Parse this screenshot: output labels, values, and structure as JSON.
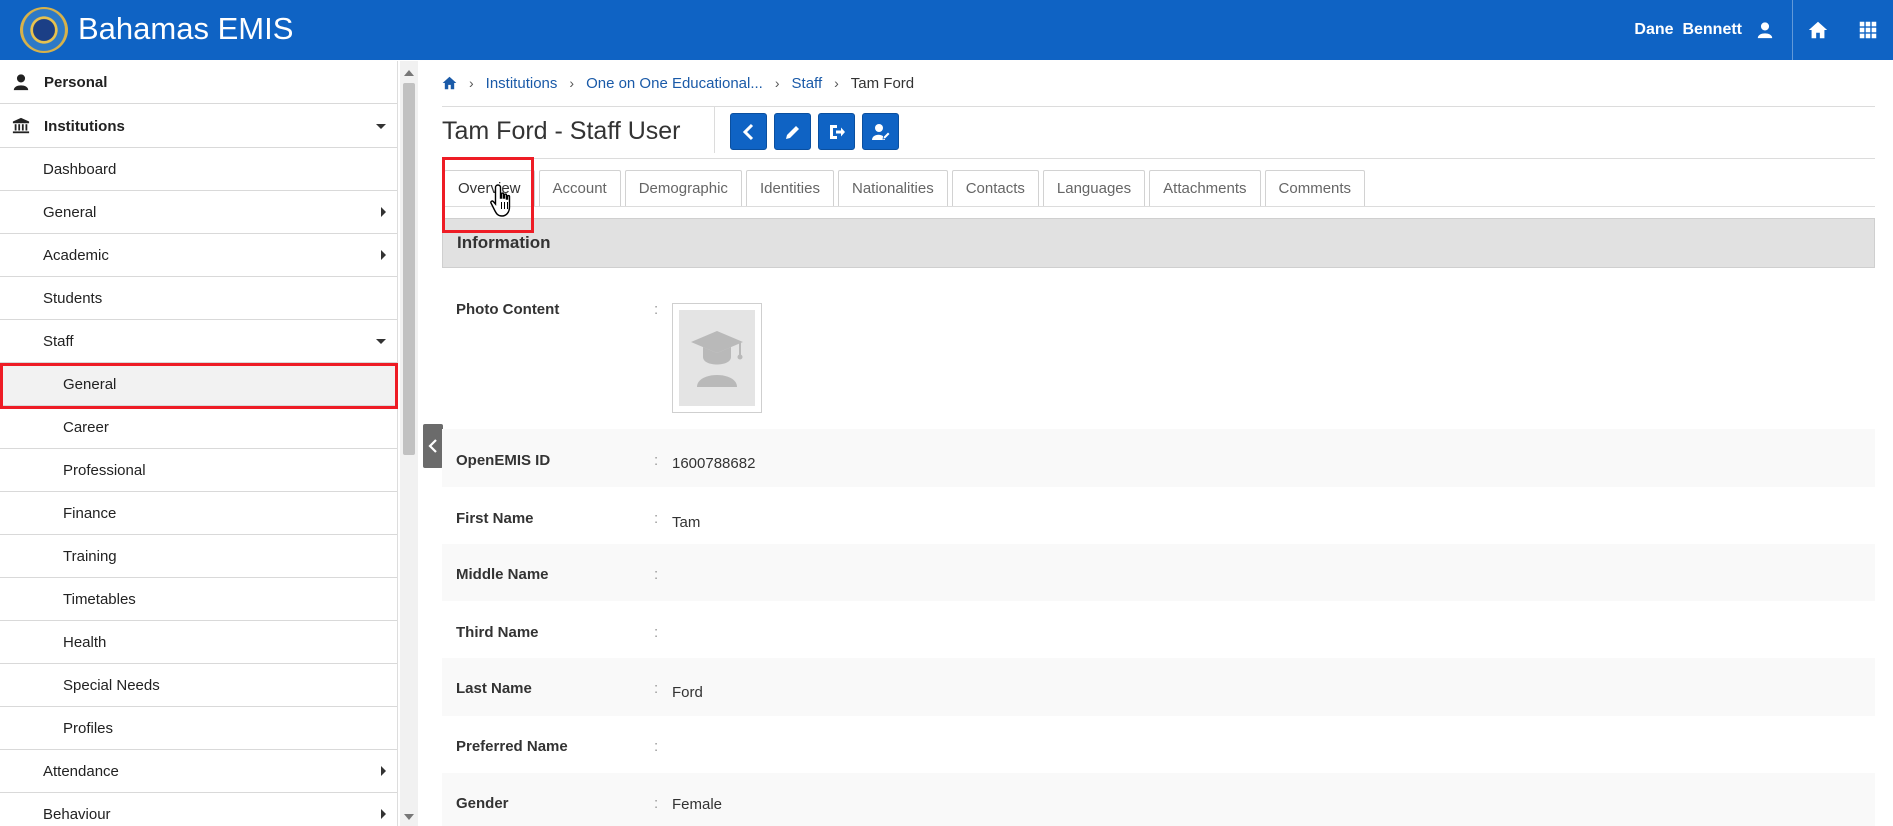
{
  "header": {
    "app_title": "Bahamas EMIS",
    "user_first": "Dane",
    "user_last": "Bennett",
    "brand_color": "#0f63c4"
  },
  "sidebar": {
    "items": [
      {
        "label": "Personal",
        "level": 0,
        "icon": "user-icon"
      },
      {
        "label": "Institutions",
        "level": 0,
        "icon": "institution-icon",
        "caret": "down"
      },
      {
        "label": "Dashboard",
        "level": 1
      },
      {
        "label": "General",
        "level": 1,
        "caret": "right"
      },
      {
        "label": "Academic",
        "level": 1,
        "caret": "right"
      },
      {
        "label": "Students",
        "level": 1
      },
      {
        "label": "Staff",
        "level": 1,
        "caret": "down"
      },
      {
        "label": "General",
        "level": 2,
        "active": true
      },
      {
        "label": "Career",
        "level": 2
      },
      {
        "label": "Professional",
        "level": 2
      },
      {
        "label": "Finance",
        "level": 2
      },
      {
        "label": "Training",
        "level": 2
      },
      {
        "label": "Timetables",
        "level": 2
      },
      {
        "label": "Health",
        "level": 2
      },
      {
        "label": "Special Needs",
        "level": 2
      },
      {
        "label": "Profiles",
        "level": 2
      },
      {
        "label": "Attendance",
        "level": 1,
        "caret": "right"
      },
      {
        "label": "Behaviour",
        "level": 1,
        "caret": "right"
      }
    ]
  },
  "breadcrumb": {
    "items": [
      "Institutions",
      "One on One Educational...",
      "Staff"
    ],
    "current": "Tam Ford"
  },
  "page": {
    "title": "Tam Ford - Staff User"
  },
  "tabs": [
    "Overview",
    "Account",
    "Demographic",
    "Identities",
    "Nationalities",
    "Contacts",
    "Languages",
    "Attachments",
    "Comments"
  ],
  "section": {
    "title": "Information"
  },
  "fields": {
    "photo_label": "Photo Content",
    "colon": ":",
    "rows": [
      {
        "label": "OpenEMIS ID",
        "value": "1600788682"
      },
      {
        "label": "First Name",
        "value": "Tam"
      },
      {
        "label": "Middle Name",
        "value": ""
      },
      {
        "label": "Third Name",
        "value": ""
      },
      {
        "label": "Last Name",
        "value": "Ford"
      },
      {
        "label": "Preferred Name",
        "value": ""
      },
      {
        "label": "Gender",
        "value": "Female"
      }
    ]
  },
  "colors": {
    "highlight": "#ee1c25",
    "link": "#1a5aa8"
  }
}
